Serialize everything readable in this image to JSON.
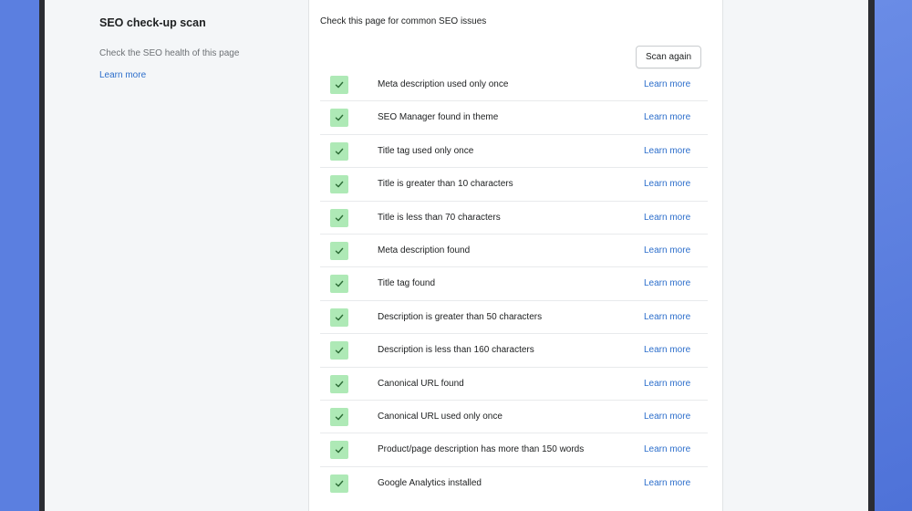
{
  "sidebar": {
    "title": "SEO check-up scan",
    "description": "Check the SEO health of this page",
    "link": "Learn more"
  },
  "card": {
    "title": "Check this page for common SEO issues",
    "scan_button": "Scan again"
  },
  "checks": [
    {
      "label": "Meta description used only once",
      "status": "passed",
      "link": "Learn more"
    },
    {
      "label": "SEO Manager found in theme",
      "status": "passed",
      "link": "Learn more"
    },
    {
      "label": "Title tag used only once",
      "status": "passed",
      "link": "Learn more"
    },
    {
      "label": "Title is greater than 10 characters",
      "status": "passed",
      "link": "Learn more"
    },
    {
      "label": "Title is less than 70 characters",
      "status": "passed",
      "link": "Learn more"
    },
    {
      "label": "Meta description found",
      "status": "passed",
      "link": "Learn more"
    },
    {
      "label": "Title tag found",
      "status": "passed",
      "link": "Learn more"
    },
    {
      "label": "Description is greater than 50 characters",
      "status": "passed",
      "link": "Learn more"
    },
    {
      "label": "Description is less than 160 characters",
      "status": "passed",
      "link": "Learn more"
    },
    {
      "label": "Canonical URL found",
      "status": "passed",
      "link": "Learn more"
    },
    {
      "label": "Canonical URL used only once",
      "status": "passed",
      "link": "Learn more"
    },
    {
      "label": "Product/page description has more than 150 words",
      "status": "passed",
      "link": "Learn more"
    },
    {
      "label": "Google Analytics installed",
      "status": "passed",
      "link": "Learn more"
    }
  ],
  "colors": {
    "background": "#5b7fe0",
    "check_bg": "#aee9b6",
    "check_mark": "#2b6b35",
    "link": "#2c6ecb"
  },
  "icons": {
    "check": "check-icon"
  }
}
